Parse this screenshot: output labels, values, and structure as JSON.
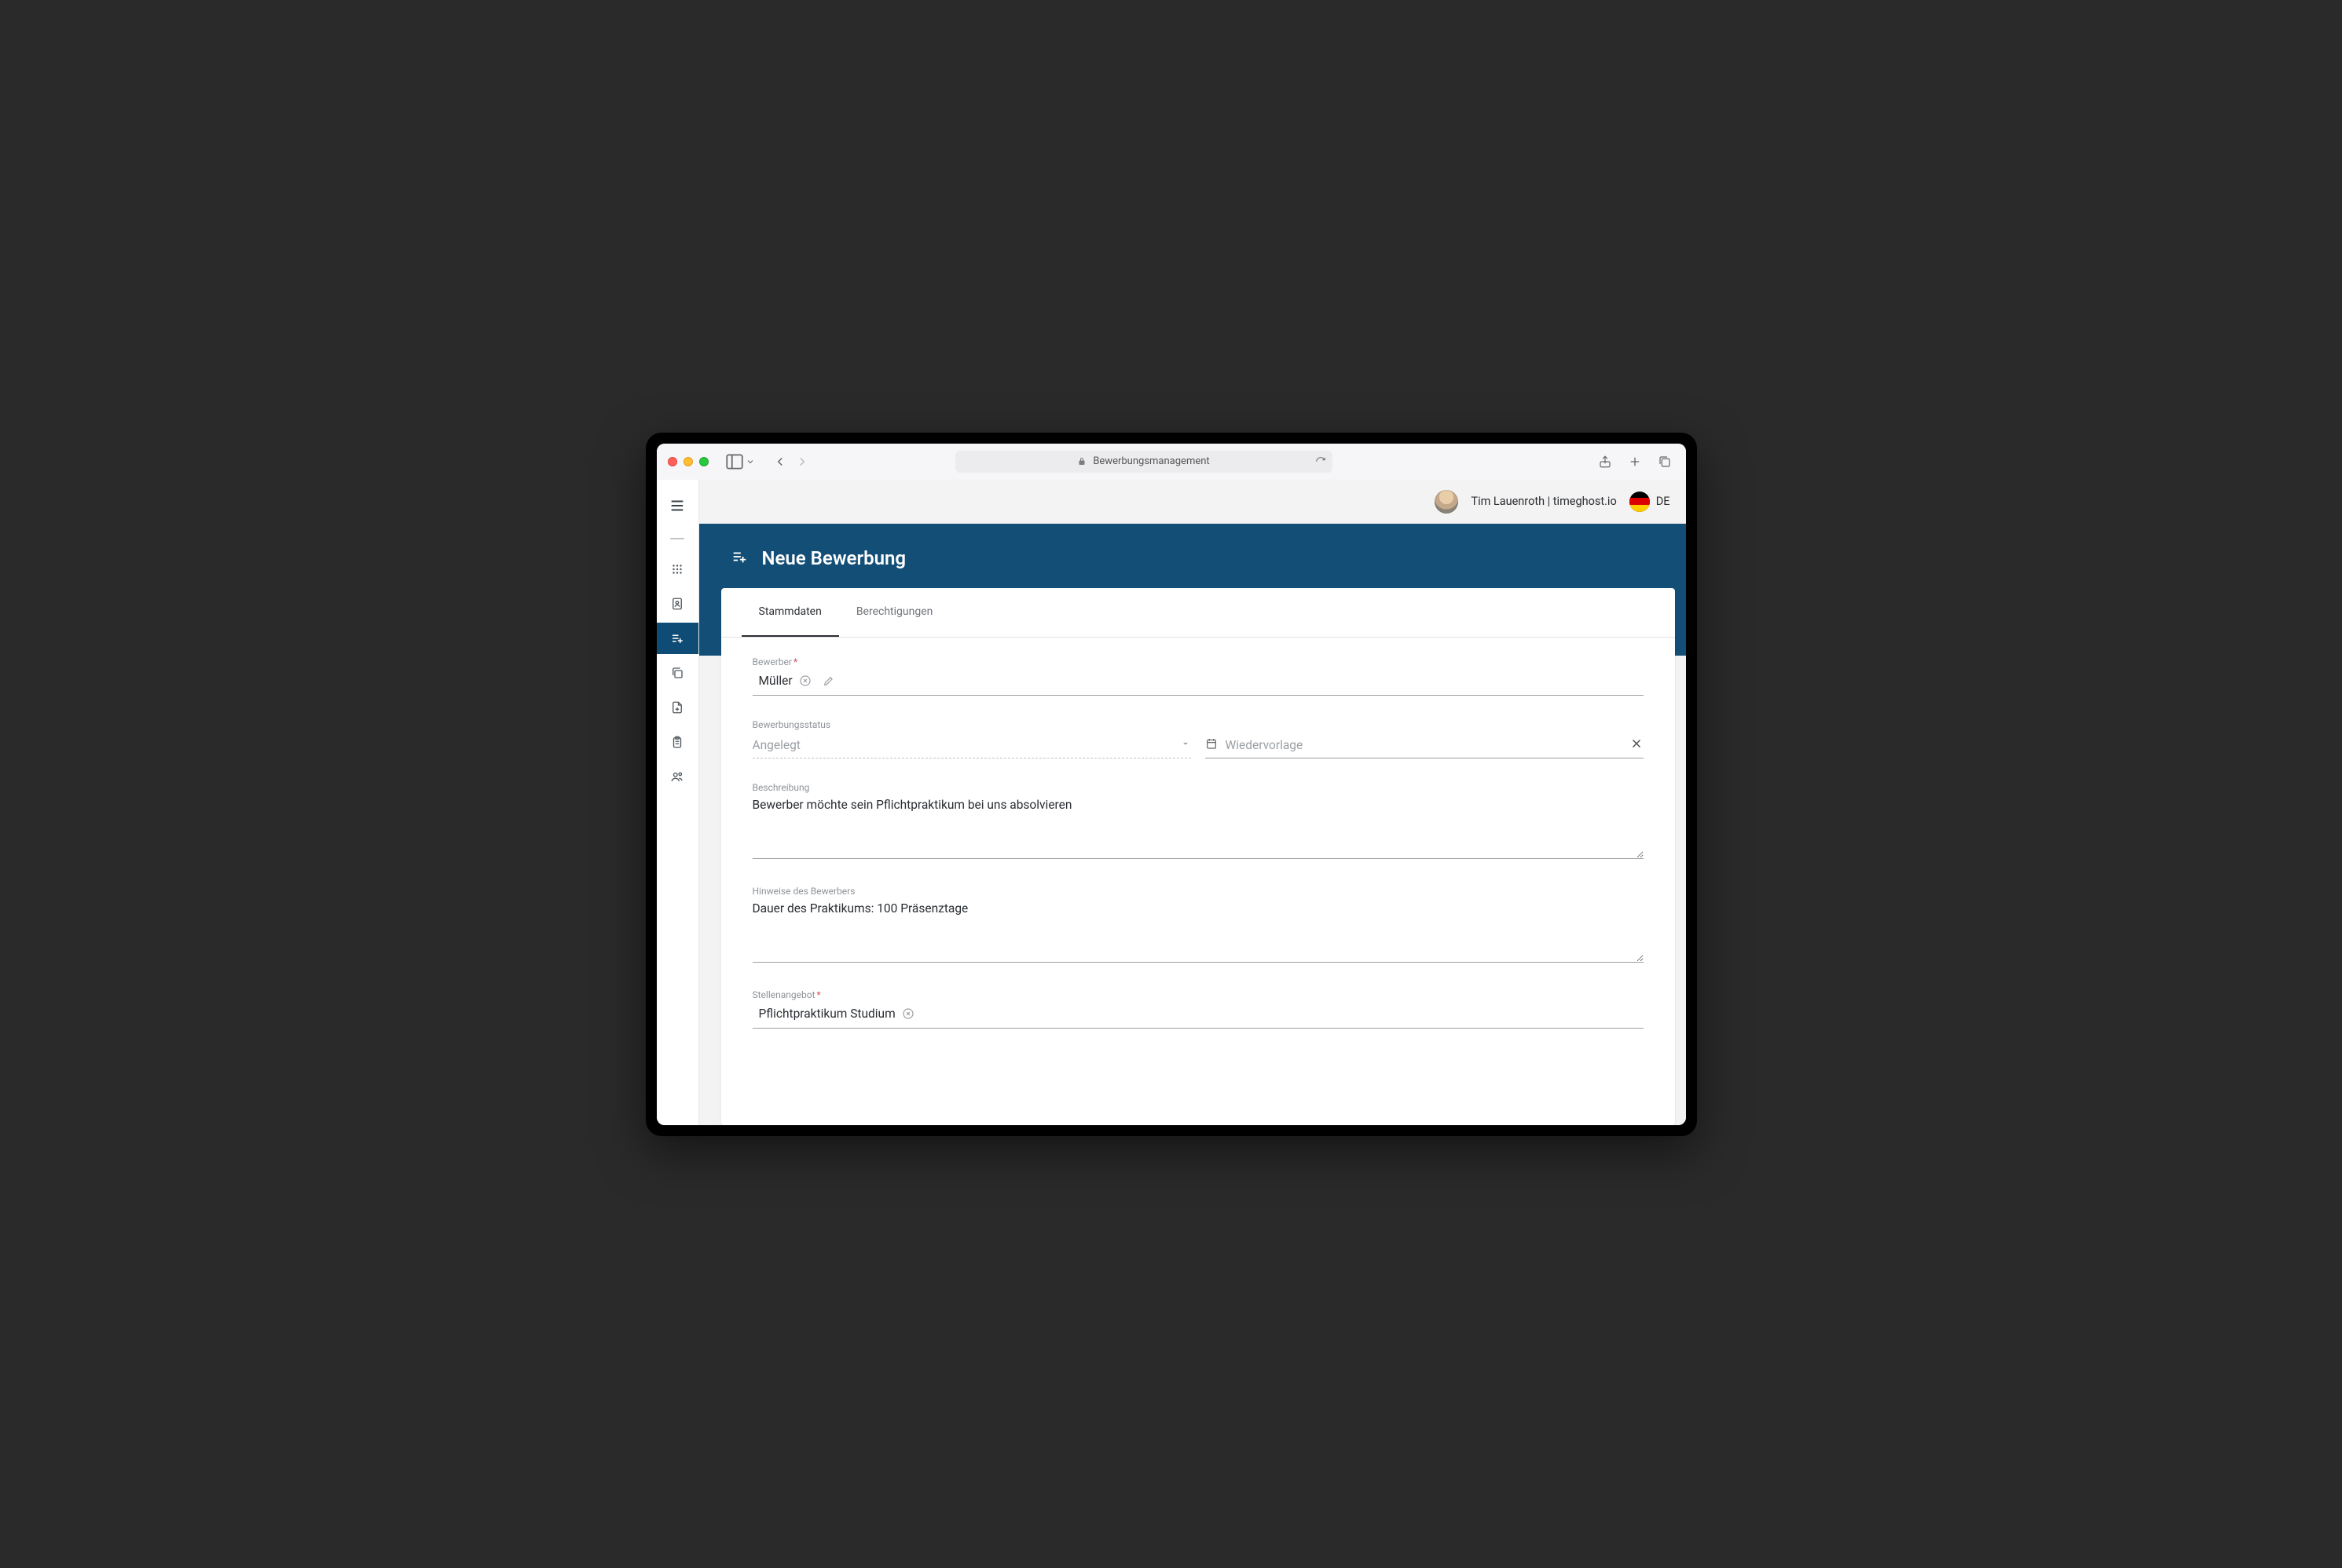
{
  "browser": {
    "url_label": "Bewerbungsmanagement"
  },
  "header": {
    "user_name": "Tim Lauenroth | timeghost.io",
    "locale": "DE"
  },
  "hero": {
    "title": "Neue Bewerbung"
  },
  "tabs": {
    "stammdaten": "Stammdaten",
    "berechtigungen": "Berechtigungen"
  },
  "form": {
    "bewerber": {
      "label": "Bewerber",
      "chip_value": "Müller"
    },
    "status": {
      "label": "Bewerbungsstatus",
      "value": "Angelegt"
    },
    "wiedervorlage": {
      "placeholder": "Wiedervorlage"
    },
    "beschreibung": {
      "label": "Beschreibung",
      "value": "Bewerber möchte sein Pflichtpraktikum bei uns absolvieren"
    },
    "hinweise": {
      "label": "Hinweise des Bewerbers",
      "value": "Dauer des Praktikums: 100 Präsenztage"
    },
    "stellenangebot": {
      "label": "Stellenangebot",
      "chip_value": "Pflichtpraktikum Studium"
    }
  }
}
